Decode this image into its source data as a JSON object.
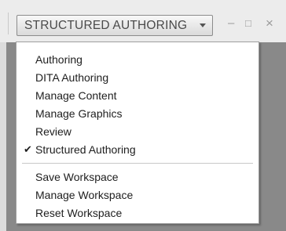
{
  "workspace_switcher": {
    "current": "STRUCTURED AUTHORING",
    "arrow_icon": "dropdown-arrow-icon"
  },
  "window_controls": {
    "minimize": "–",
    "maximize": "□",
    "close": "×"
  },
  "menu": {
    "workspaces": [
      {
        "label": "Authoring"
      },
      {
        "label": "DITA Authoring"
      },
      {
        "label": "Manage Content"
      },
      {
        "label": "Manage Graphics"
      },
      {
        "label": "Review"
      },
      {
        "label": "Structured Authoring",
        "checked": true,
        "check_glyph": "✔"
      }
    ],
    "actions": [
      {
        "label": "Save Workspace"
      },
      {
        "label": "Manage Workspace"
      },
      {
        "label": "Reset Workspace"
      }
    ]
  },
  "colors": {
    "canvas_background": "#898989",
    "menu_background": "#ffffff",
    "toolbar_background": "#ececec"
  }
}
